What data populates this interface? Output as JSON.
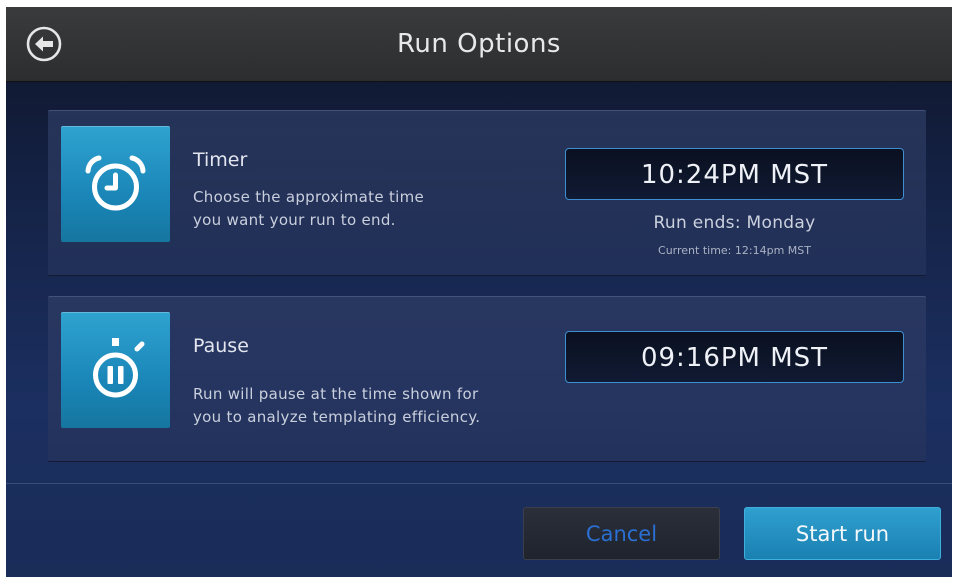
{
  "header": {
    "title": "Run Options",
    "back_icon": "arrow-left-circle-icon"
  },
  "timer": {
    "icon": "alarm-clock-icon",
    "title": "Timer",
    "description_line1": "Choose the approximate time",
    "description_line2": "you want your run to end.",
    "time_value": "10:24PM MST",
    "run_ends": "Run ends: Monday",
    "current_time": "Current time: 12:14pm MST"
  },
  "pause": {
    "icon": "stopwatch-pause-icon",
    "title": "Pause",
    "description_line1": "Run will pause at the time shown for",
    "description_line2": "you to analyze templating efficiency.",
    "time_value": "09:16PM MST"
  },
  "footer": {
    "cancel_label": "Cancel",
    "start_label": "Start run"
  },
  "colors": {
    "accent_blue": "#1f8fc2",
    "cancel_text": "#2a6fd1",
    "field_border": "#3e8fd0"
  }
}
